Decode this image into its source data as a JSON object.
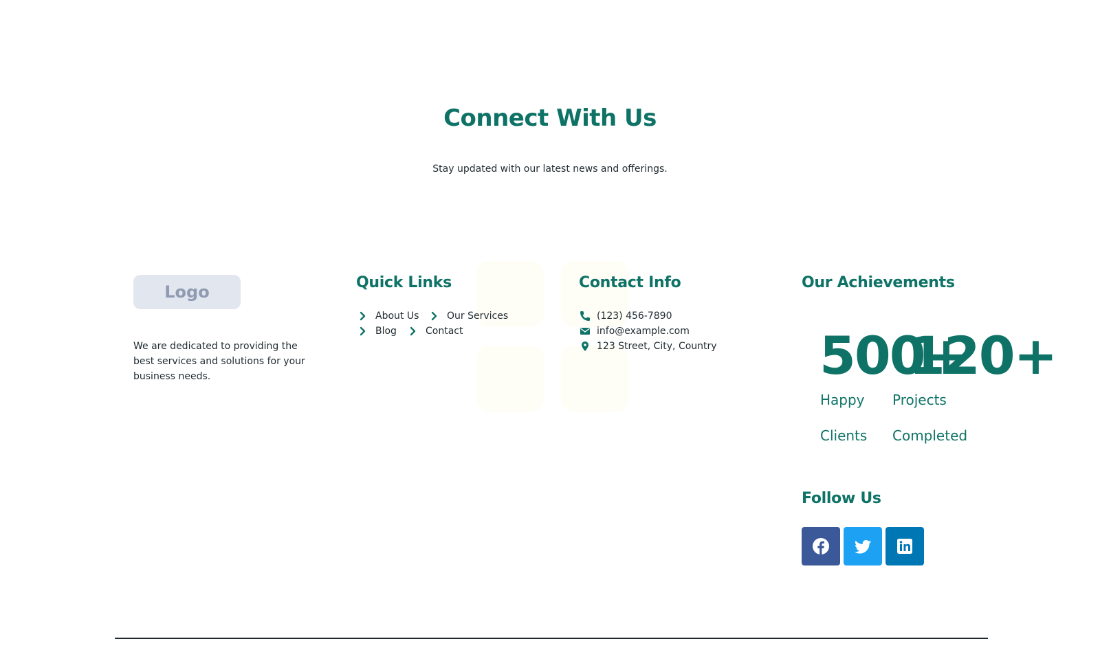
{
  "header": {
    "title": "Connect With Us",
    "subtitle": "Stay updated with our latest news and offerings."
  },
  "brand": {
    "logo_text": "Logo",
    "description": "We are dedicated to providing the best services and solutions for your business needs."
  },
  "quick_links": {
    "heading": "Quick Links",
    "items": [
      {
        "label": "About Us"
      },
      {
        "label": "Our Services"
      },
      {
        "label": "Blog"
      },
      {
        "label": "Contact"
      }
    ]
  },
  "contact_info": {
    "heading": "Contact Info",
    "phone": "(123) 456-7890",
    "email": "info@example.com",
    "address": "123 Street, City, Country",
    "icons": [
      "phone-icon",
      "envelope-icon",
      "map-marker-icon"
    ]
  },
  "achievements": {
    "heading": "Our Achievements",
    "stats": [
      {
        "number": "500+",
        "label": "Happy\nClients"
      },
      {
        "number": "120+",
        "label": "Projects\nCompleted"
      }
    ]
  },
  "follow": {
    "heading": "Follow Us",
    "networks": [
      {
        "name": "facebook",
        "icon": "facebook-icon",
        "color": "#3b5998"
      },
      {
        "name": "twitter",
        "icon": "twitter-icon",
        "color": "#1da1f2"
      },
      {
        "name": "linkedin",
        "icon": "linkedin-icon",
        "color": "#0077b5"
      }
    ]
  },
  "colors": {
    "accent": "#0e7366",
    "text": "#1f2a30",
    "logo_bg": "#e1e6ef",
    "logo_text": "#8e9bb0"
  }
}
